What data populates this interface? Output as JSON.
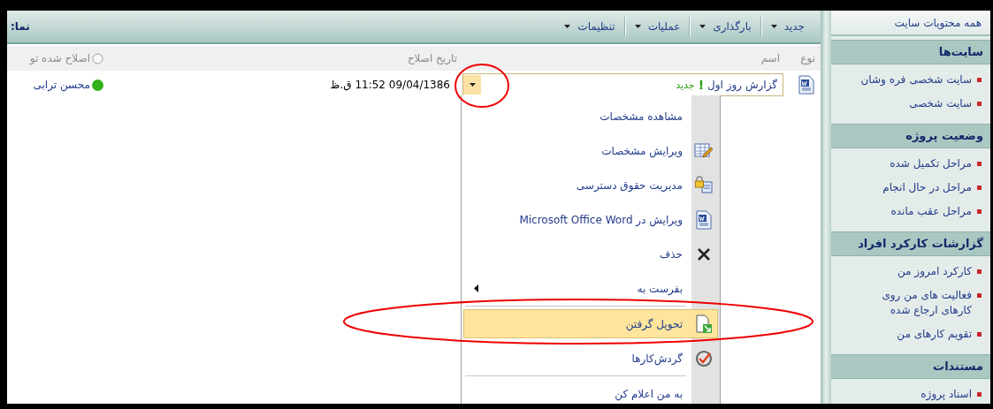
{
  "sidebar": {
    "top_link": "همه محتویات سایت",
    "sections": [
      {
        "title": "سایت‌ها",
        "items": [
          "سایت شخصی فره وشان",
          "سایت شخصی"
        ]
      },
      {
        "title": "وضعیت پروژه",
        "items": [
          "مراحل تکمیل شده",
          "مراحل در حال انجام",
          "مراحل عقب مانده"
        ]
      },
      {
        "title": "گزارشات کارکرد افراد",
        "items": [
          "کارکرد امروز من",
          "فعالیت های من روی کارهای ارجاع شده",
          "تقویم کارهای من"
        ]
      },
      {
        "title": "مستندات",
        "items": [
          "اسناد پروژه"
        ]
      }
    ]
  },
  "toolbar": {
    "menus": [
      "جدید",
      "بارگذاری",
      "عملیات",
      "تنظیمات"
    ],
    "view_label": "نما:"
  },
  "table": {
    "columns": [
      "نوع",
      "اسم",
      "تاریخ اصلاح",
      "اصلاح شده تو"
    ],
    "rows": [
      {
        "name": "گزارش روز اول",
        "new_marker": "!",
        "new_badge": "جدید",
        "modified": "09/04/1386 11:52 ق.ظ",
        "modified_by": "محسن ترابی",
        "color": "#33b01c"
      }
    ]
  },
  "context_menu": {
    "items": [
      {
        "kind": "plain",
        "label": "مشاهده مشخصات",
        "selected": false,
        "separator_before": false
      },
      {
        "kind": "table",
        "label": "ویرایش مشخصات",
        "selected": false,
        "separator_before": false
      },
      {
        "kind": "lock",
        "label": "مدیریت حقوق دسترسی",
        "selected": false,
        "separator_before": false
      },
      {
        "kind": "word",
        "label": "ویرایش در Microsoft Office Word",
        "selected": false,
        "separator_before": false
      },
      {
        "kind": "cross",
        "label": "حذف",
        "selected": false,
        "separator_before": false
      },
      {
        "kind": "submenu",
        "label": "بفرست به",
        "selected": false,
        "separator_before": false
      },
      {
        "kind": "checkout",
        "label": "تحویل گرفتن",
        "selected": true,
        "separator_before": true
      },
      {
        "kind": "workflow",
        "label": "گردش‌کارها",
        "selected": false,
        "separator_before": false
      },
      {
        "kind": "plain",
        "label": "به من اعلام کن",
        "selected": false,
        "separator_before": true
      }
    ]
  }
}
